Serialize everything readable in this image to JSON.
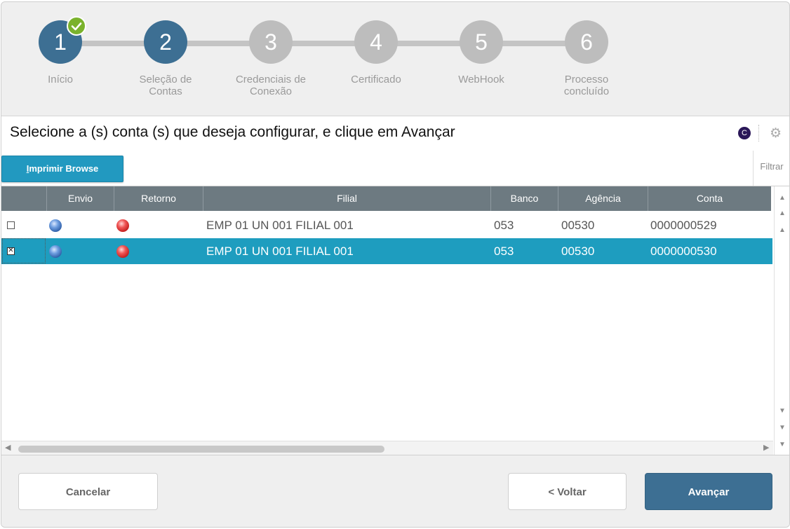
{
  "stepper": {
    "steps": [
      {
        "number": "1",
        "label": "Início",
        "state": "completed"
      },
      {
        "number": "2",
        "label": "Seleção de Contas",
        "state": "current"
      },
      {
        "number": "3",
        "label": "Credenciais de Conexão",
        "state": "pending"
      },
      {
        "number": "4",
        "label": "Certificado",
        "state": "pending"
      },
      {
        "number": "5",
        "label": "WebHook",
        "state": "pending"
      },
      {
        "number": "6",
        "label": "Processo concluído",
        "state": "pending"
      }
    ],
    "colors": {
      "active": "#3d6f93",
      "pending": "#bdbdbd",
      "check": "#7ab22c"
    }
  },
  "header": {
    "title": "Selecione a (s) conta (s) que deseja configurar, e clique em Avançar",
    "app_icon": "C"
  },
  "toolbar": {
    "print_prefix": "I",
    "print_rest": "mprimir Browse",
    "filter_label": "Filtrar"
  },
  "grid": {
    "columns": [
      "",
      "Envio",
      "Retorno",
      "Filial",
      "Banco",
      "Agência",
      "Conta"
    ],
    "rows": [
      {
        "checked": false,
        "envio": "blue",
        "retorno": "red",
        "filial": "EMP 01 UN 001 FILIAL 001",
        "banco": "053",
        "agencia": "00530",
        "conta": "0000000529"
      },
      {
        "checked": true,
        "envio": "blue",
        "retorno": "red",
        "filial": "EMP 01 UN 001 FILIAL 001",
        "banco": "053",
        "agencia": "00530",
        "conta": "0000000530"
      }
    ],
    "selected_row_color": "#1e9dbf",
    "header_color": "#6d7a81"
  },
  "footer": {
    "cancel_label": "Cancelar",
    "back_label": "< Voltar",
    "next_label": "Avançar"
  }
}
